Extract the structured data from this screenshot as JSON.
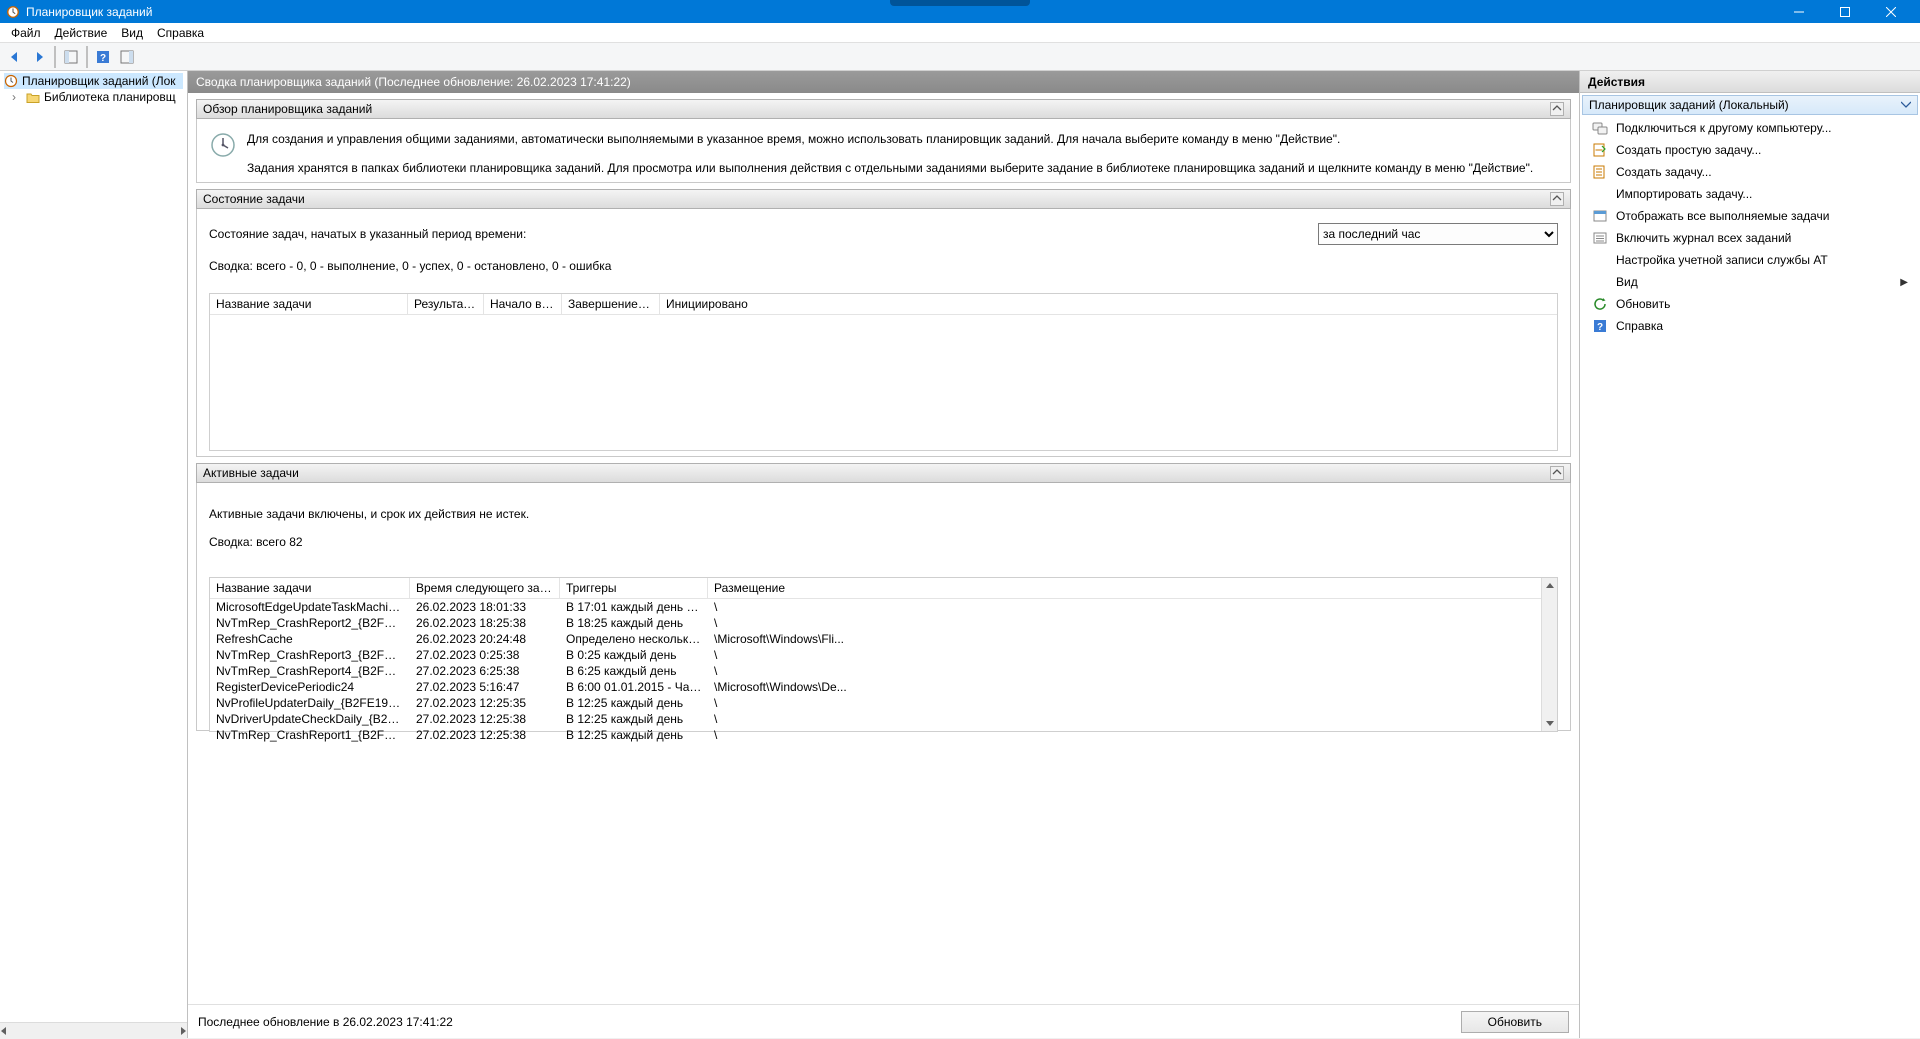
{
  "app": {
    "title": "Планировщик заданий"
  },
  "menu": {
    "file": "Файл",
    "action": "Действие",
    "view": "Вид",
    "help": "Справка"
  },
  "tree": {
    "root": "Планировщик заданий (Лок",
    "library": "Библиотека планировщ"
  },
  "center": {
    "header": "Сводка планировщика заданий (Последнее обновление: 26.02.2023 17:41:22)",
    "overview": {
      "title": "Обзор планировщика заданий",
      "p1": "Для создания и управления общими заданиями, автоматически выполняемыми в указанное время, можно использовать планировщик заданий. Для начала выберите команду в меню \"Действие\".",
      "p2": "Задания хранятся в папках библиотеки планировщика заданий. Для просмотра или выполнения действия с отдельными заданиями выберите задание в библиотеке планировщика заданий и щелкните команду в меню \"Действие\"."
    },
    "status": {
      "title": "Состояние задачи",
      "label": "Состояние задач, начатых в указанный период времени:",
      "period_selected": "за последний час",
      "summary": "Сводка: всего - 0, 0 - выполнение, 0 - успех, 0 - остановлено, 0 - ошибка",
      "cols": {
        "c1": "Название задачи",
        "c2": "Результат...",
        "c3": "Начало выпо...",
        "c4": "Завершение в...",
        "c5": "Инициировано"
      }
    },
    "active": {
      "title": "Активные задачи",
      "desc": "Активные задачи включены, и срок их действия не истек.",
      "summary": "Сводка: всего 82",
      "cols": {
        "c1": "Название задачи",
        "c2": "Время следующего зап...",
        "c3": "Триггеры",
        "c4": "Размещение"
      },
      "rows": [
        {
          "name": "MicrosoftEdgeUpdateTaskMachine...",
          "time": "26.02.2023 18:01:33",
          "trig": "В 17:01 каждый день - ...",
          "loc": "\\"
        },
        {
          "name": "NvTmRep_CrashReport2_{B2FE195...",
          "time": "26.02.2023 18:25:38",
          "trig": "В 18:25 каждый день",
          "loc": "\\"
        },
        {
          "name": "RefreshCache",
          "time": "26.02.2023 20:24:48",
          "trig": "Определено несколько...",
          "loc": "\\Microsoft\\Windows\\Fli..."
        },
        {
          "name": "NvTmRep_CrashReport3_{B2FE195...",
          "time": "27.02.2023 0:25:38",
          "trig": "В 0:25 каждый день",
          "loc": "\\"
        },
        {
          "name": "NvTmRep_CrashReport4_{B2FE195...",
          "time": "27.02.2023 6:25:38",
          "trig": "В 6:25 каждый день",
          "loc": "\\"
        },
        {
          "name": "RegisterDevicePeriodic24",
          "time": "27.02.2023 5:16:47",
          "trig": "В 6:00 01.01.2015 - Част...",
          "loc": "\\Microsoft\\Windows\\De..."
        },
        {
          "name": "NvProfileUpdaterDaily_{B2FE1952-...",
          "time": "27.02.2023 12:25:35",
          "trig": "В 12:25 каждый день",
          "loc": "\\"
        },
        {
          "name": "NvDriverUpdateCheckDaily_{B2FE1...",
          "time": "27.02.2023 12:25:38",
          "trig": "В 12:25 каждый день",
          "loc": "\\"
        },
        {
          "name": "NvTmRep_CrashReport1_{B2FE195...",
          "time": "27.02.2023 12:25:38",
          "trig": "В 12:25 каждый день",
          "loc": "\\"
        }
      ]
    },
    "footer": {
      "updated": "Последнее обновление в 26.02.2023 17:41:22",
      "refresh": "Обновить"
    }
  },
  "actions": {
    "header": "Действия",
    "subheader": "Планировщик заданий (Локальный)",
    "items": {
      "connect": "Подключиться к другому компьютеру...",
      "basic_task": "Создать простую задачу...",
      "create_task": "Создать задачу...",
      "import_task": "Импортировать задачу...",
      "running_tasks": "Отображать все выполняемые задачи",
      "enable_history": "Включить журнал всех заданий",
      "at_config": "Настройка учетной записи службы AT",
      "view": "Вид",
      "refresh": "Обновить",
      "help": "Справка"
    }
  }
}
